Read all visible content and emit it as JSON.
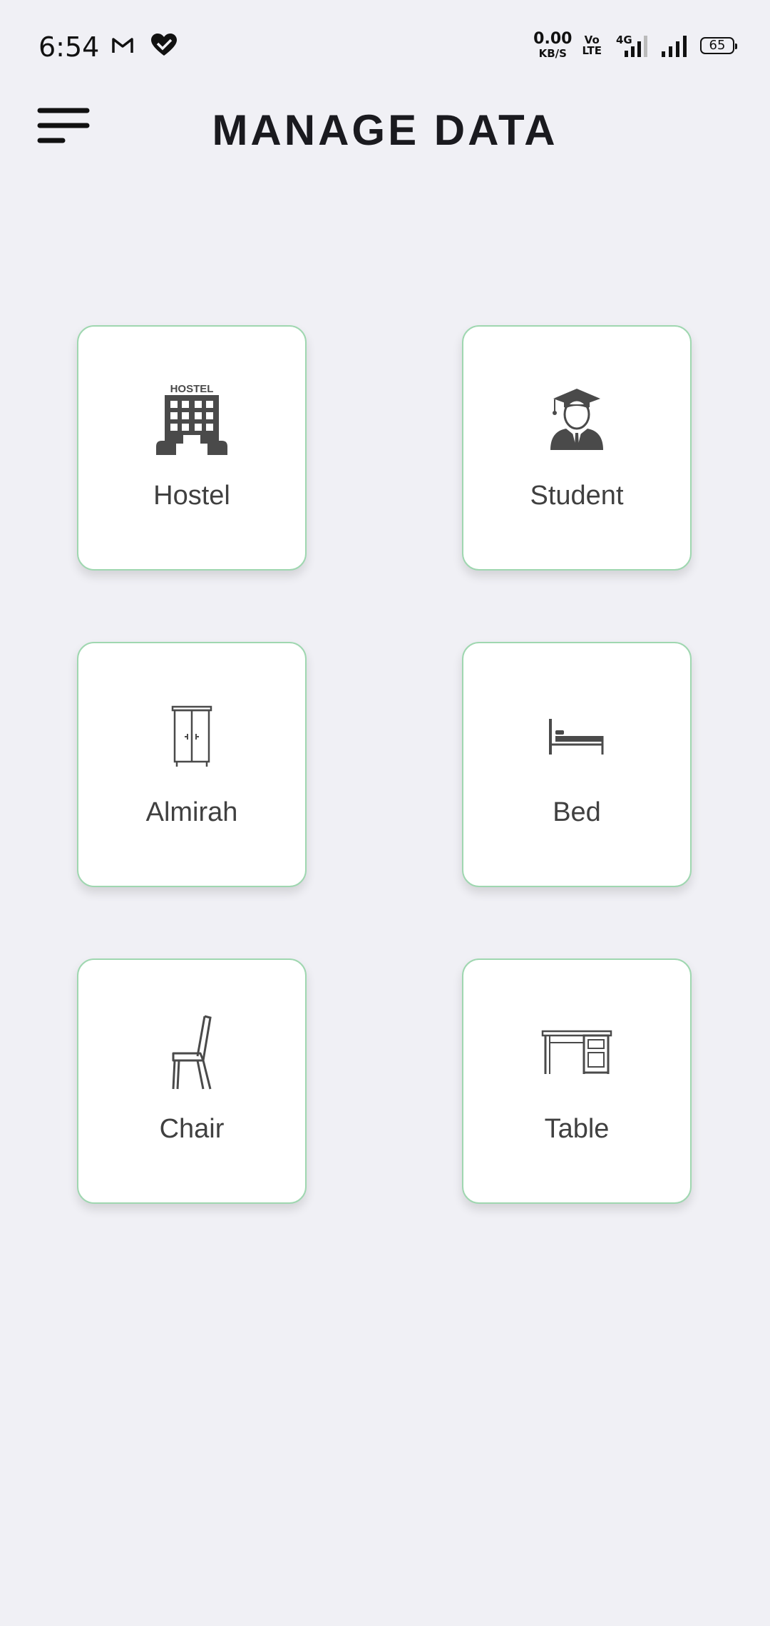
{
  "status_bar": {
    "time": "6:54",
    "net_speed_value": "0.00",
    "net_speed_unit": "KB/S",
    "volte_line1": "Vo",
    "volte_line2": "LTE",
    "network_type": "4G",
    "battery_level": "65",
    "left_icons": [
      "gmail-icon",
      "health-icon"
    ]
  },
  "header": {
    "title": "MANAGE DATA",
    "menu_icon": "hamburger-menu-icon"
  },
  "cards": [
    {
      "label": "Hostel",
      "icon": "hostel-icon"
    },
    {
      "label": "Student",
      "icon": "student-icon"
    },
    {
      "label": "Almirah",
      "icon": "almirah-icon"
    },
    {
      "label": "Bed",
      "icon": "bed-icon"
    },
    {
      "label": "Chair",
      "icon": "chair-icon"
    },
    {
      "label": "Table",
      "icon": "table-icon"
    }
  ],
  "colors": {
    "background": "#f0f0f5",
    "card_border": "#9fd7b0",
    "icon": "#4a4a4a",
    "title": "#1a1a1f"
  }
}
